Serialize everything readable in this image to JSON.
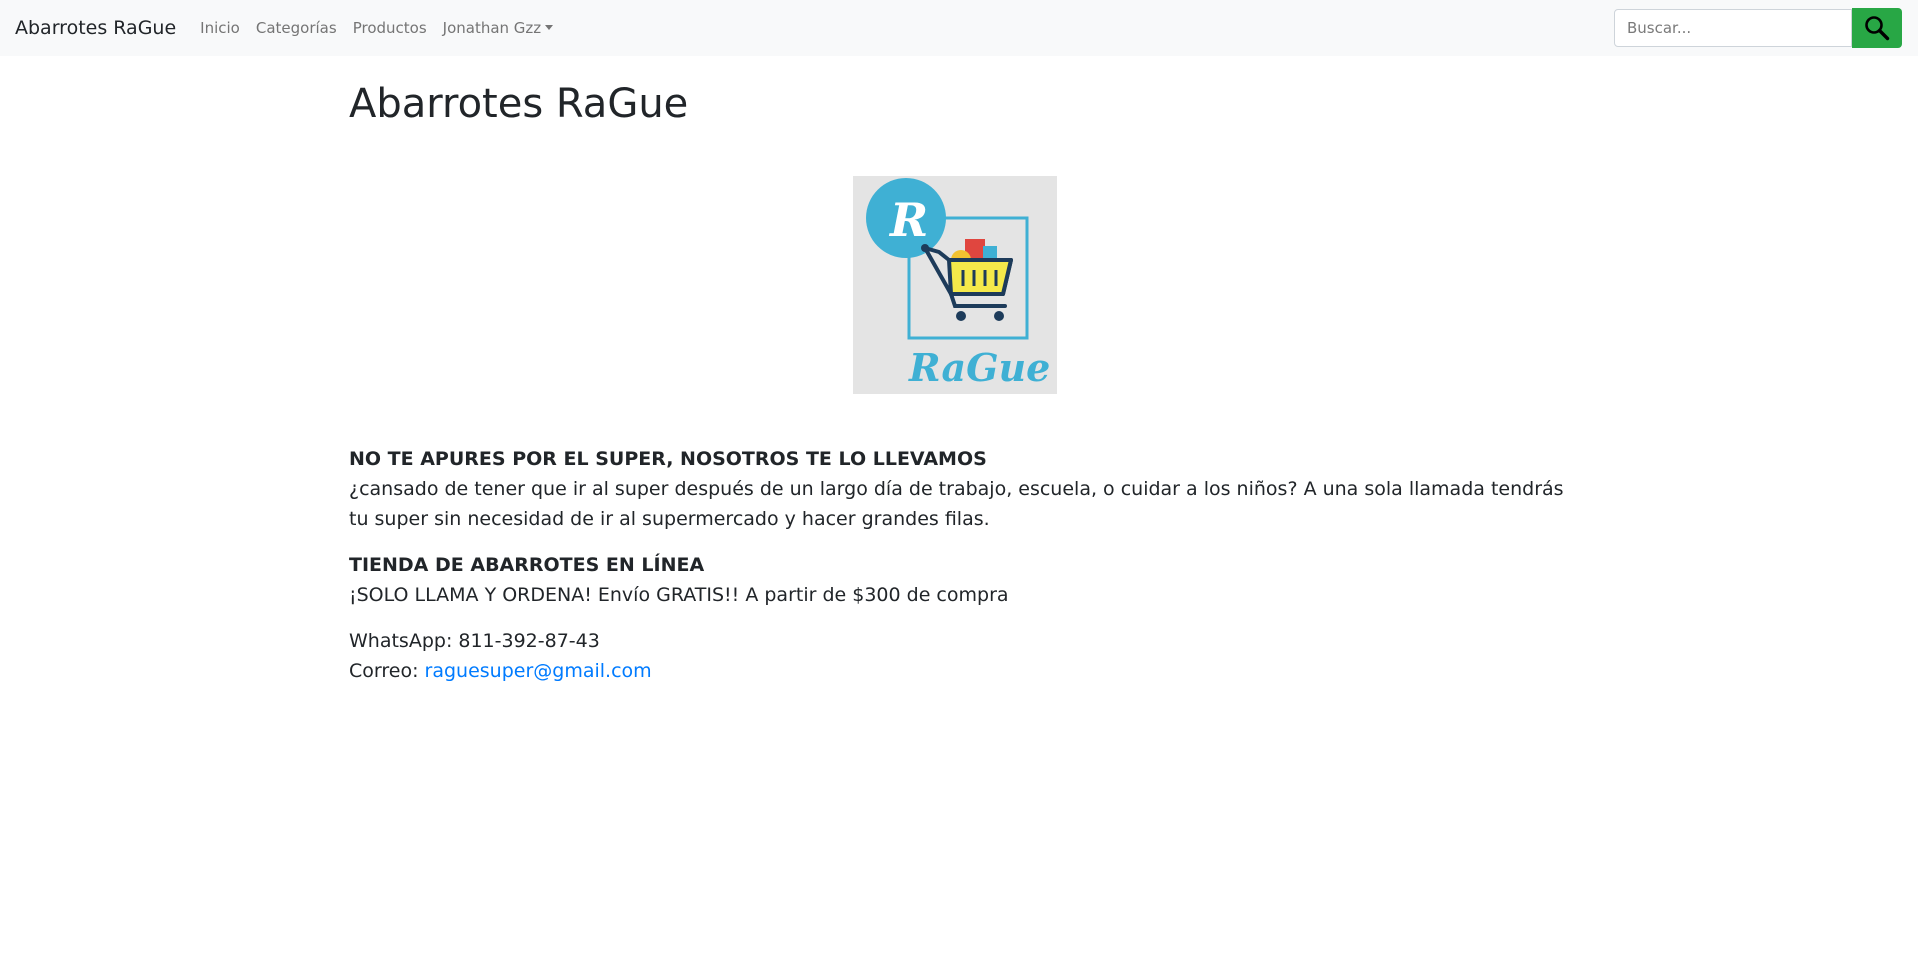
{
  "navbar": {
    "brand": "Abarrotes RaGue",
    "links": [
      "Inicio",
      "Categorías",
      "Productos"
    ],
    "user_menu": "Jonathan Gzz",
    "search_placeholder": "Buscar...",
    "search_icon": "search-icon",
    "search_button_color": "#28a745"
  },
  "main": {
    "title": "Abarrotes RaGue",
    "logo": {
      "brand_text": "RaGue",
      "letter": "R"
    },
    "block1": {
      "heading": "NO TE APURES POR EL SUPER, NOSOTROS TE LO LLEVAMOS",
      "text": "¿cansado de tener que ir al super después de un largo día de trabajo, escuela, o cuidar a los niños? A una sola llamada tendrás tu super sin necesidad de ir al supermercado y hacer grandes filas."
    },
    "block2": {
      "heading": "TIENDA DE ABARROTES EN LÍNEA",
      "text": "¡SOLO LLAMA Y ORDENA! Envío GRATIS!! A partir de $300 de compra"
    },
    "contact": {
      "whatsapp": "WhatsApp: 811-392-87-43",
      "email_label": "Correo: ",
      "email": "raguesuper@gmail.com"
    }
  },
  "colors": {
    "link": "#007bff",
    "navbar_bg": "#f8f9fa",
    "logo_accent": "#3fb0d4"
  }
}
